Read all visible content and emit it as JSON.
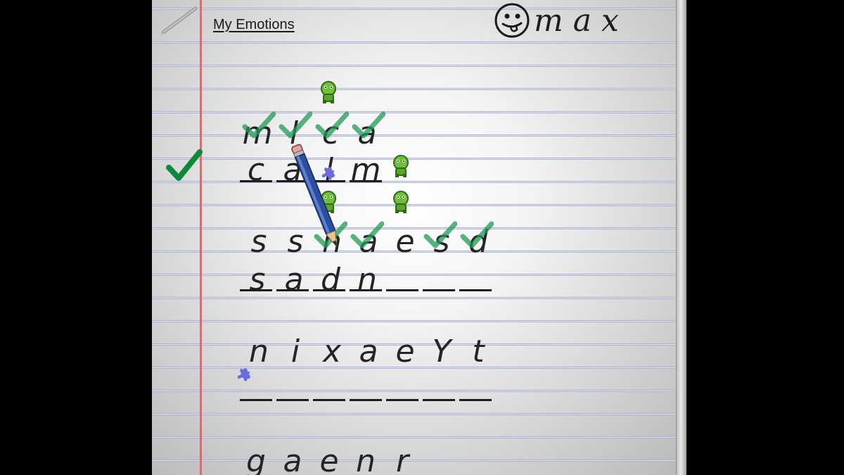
{
  "notebook": {
    "title": "My Emotions",
    "user": {
      "name": "max",
      "avatar_icon": "smiley-tongue-icon"
    }
  },
  "puzzles": [
    {
      "scrambled": [
        "m",
        "l",
        "c",
        "a"
      ],
      "scrambled_checked": [
        true,
        true,
        true,
        true
      ],
      "answer": [
        "c",
        "a",
        "l",
        "m"
      ],
      "solved": true
    },
    {
      "scrambled": [
        "s",
        "s",
        "n",
        "a",
        "e",
        "s",
        "d"
      ],
      "scrambled_checked": [
        false,
        false,
        true,
        true,
        false,
        true,
        true
      ],
      "answer": [
        "s",
        "a",
        "d",
        "n",
        "",
        "",
        ""
      ],
      "solved": false
    },
    {
      "scrambled": [
        "n",
        "i",
        "x",
        "a",
        "e",
        "Y",
        "t"
      ],
      "scrambled_checked": [
        false,
        false,
        false,
        false,
        false,
        false,
        false
      ],
      "answer": [
        "",
        "",
        "",
        "",
        "",
        "",
        ""
      ],
      "solved": false
    },
    {
      "scrambled": [
        "g",
        "a",
        "e",
        "n",
        "r"
      ],
      "scrambled_checked": [
        false,
        false,
        false,
        false,
        false
      ],
      "answer": [],
      "solved": false
    }
  ],
  "icons": {
    "check": "checkmark-icon",
    "sprite": "green-creature-icon",
    "puzzle": "puzzle-piece-icon",
    "pencil": "pencil-icon"
  },
  "colors": {
    "check": "#1f9a55",
    "big_check": "#0a8a3a",
    "margin_line": "#e06a6a",
    "rule_line": "#a3a8cf",
    "pencil_body": "#2b4f9e",
    "puzzle": "#6b6bdc"
  }
}
